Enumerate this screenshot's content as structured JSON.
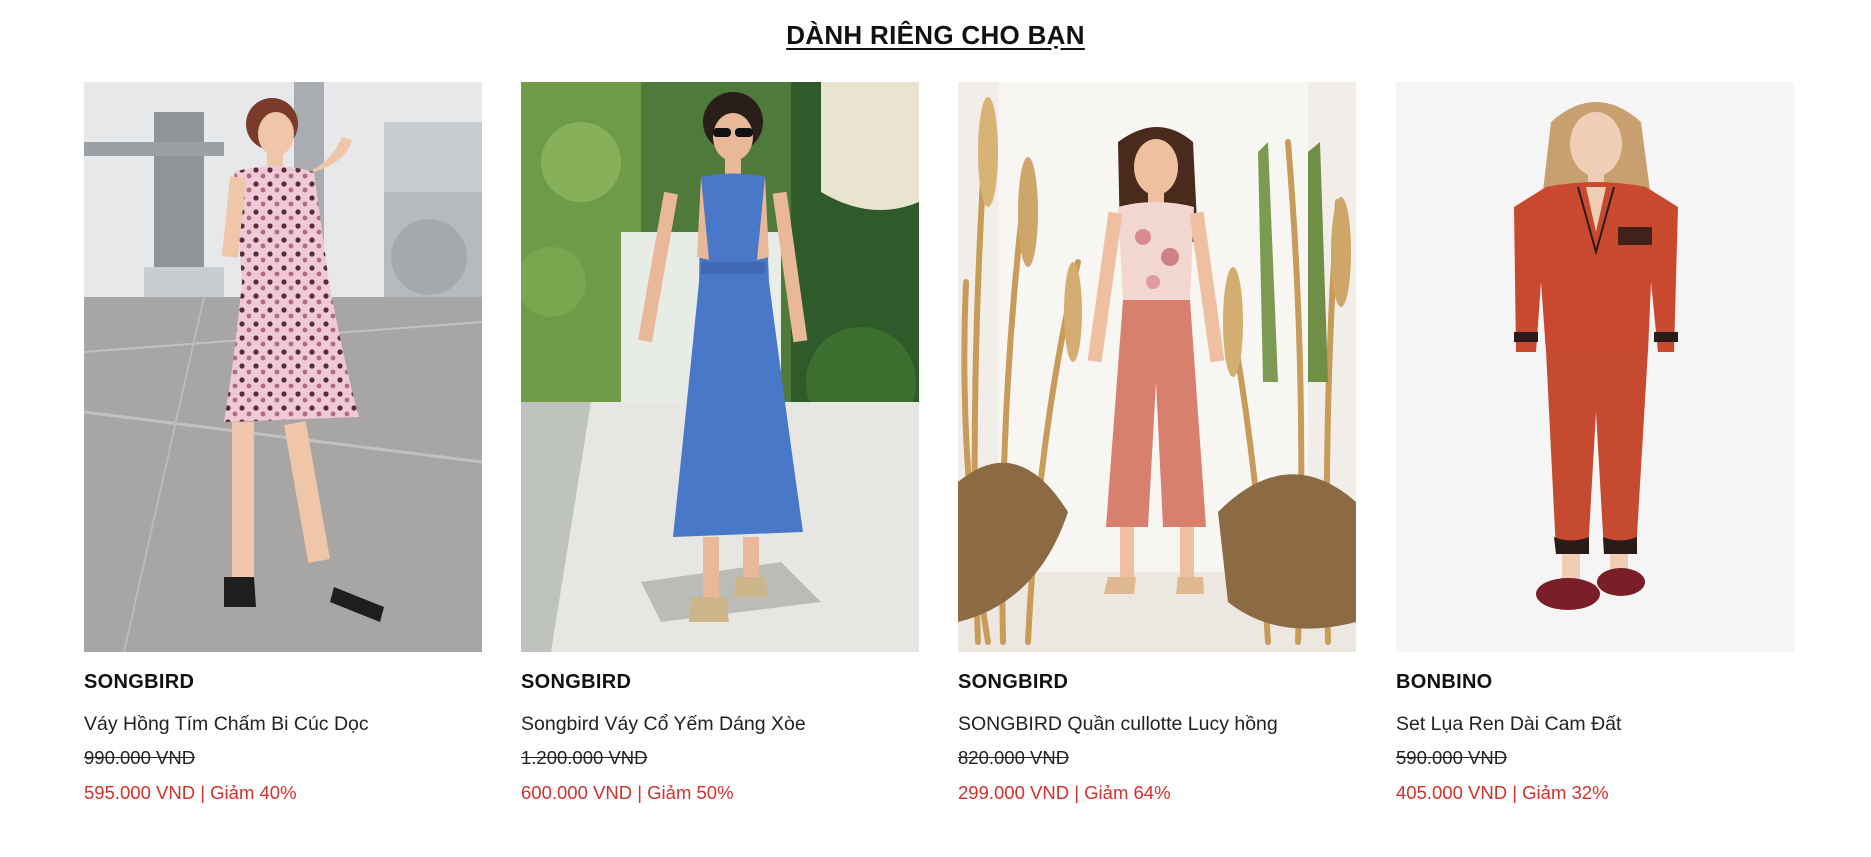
{
  "section": {
    "title": "DÀNH RIÊNG CHO BẠN"
  },
  "products": [
    {
      "image_icon": "product-photo-pink-polka-dot-dress",
      "brand": "SONGBIRD",
      "name": "Váy Hồng Tím Chấm Bi Cúc Dọc",
      "old_price": "990.000 VND",
      "new_price": "595.000 VND | Giảm 40%"
    },
    {
      "image_icon": "product-photo-blue-halter-dress",
      "brand": "SONGBIRD",
      "name": "Songbird Váy Cổ Yếm Dáng Xòe",
      "old_price": "1.200.000 VND",
      "new_price": "600.000 VND | Giảm 50%"
    },
    {
      "image_icon": "product-photo-pink-culottes",
      "brand": "SONGBIRD",
      "name": "SONGBIRD Quần cullotte Lucy hồng",
      "old_price": "820.000 VND",
      "new_price": "299.000 VND | Giảm 64%"
    },
    {
      "image_icon": "product-photo-orange-silk-pajama-set",
      "brand": "BONBINO",
      "name": "Set Lụa Ren Dài Cam Đất",
      "old_price": "590.000 VND",
      "new_price": "405.000 VND | Giảm 32%"
    }
  ],
  "colors": {
    "sale_price": "#d6302b",
    "text": "#111111",
    "background": "#ffffff"
  }
}
